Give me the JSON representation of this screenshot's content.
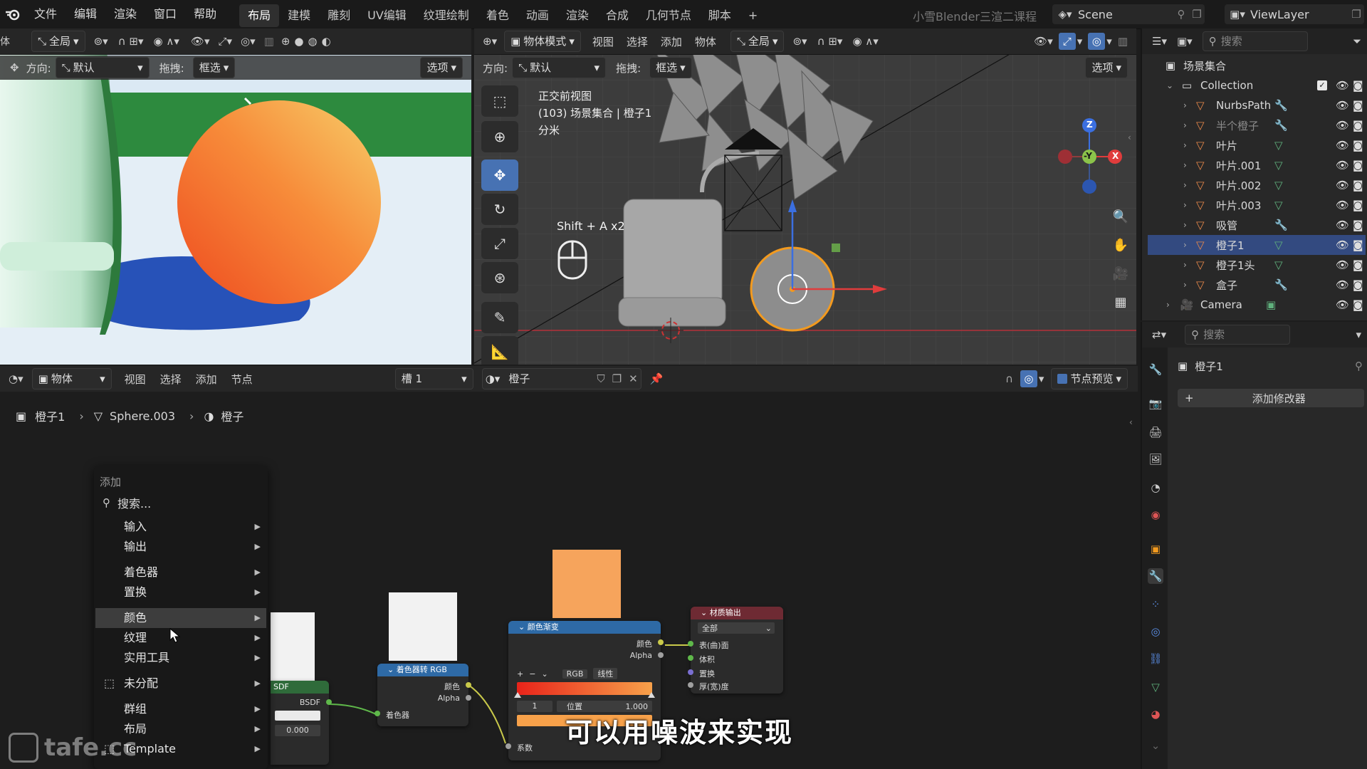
{
  "menubar": {
    "items": [
      "文件",
      "编辑",
      "渲染",
      "窗口",
      "帮助"
    ],
    "workspaces": [
      "布局",
      "建模",
      "雕刻",
      "UV编辑",
      "纹理绘制",
      "着色",
      "动画",
      "渲染",
      "合成",
      "几何节点",
      "脚本"
    ],
    "active_workspace": "布局",
    "add_tab": "+",
    "course_title": "小雪Blender三渲二课程",
    "scene_name": "Scene",
    "view_layer": "ViewLayer"
  },
  "left_viewport": {
    "header": {
      "mode_partial": "体",
      "orientation": "全局"
    },
    "header2": {
      "direction_label": "方向:",
      "direction_value": "默认",
      "drag_label": "拖拽:",
      "drag_value": "框选",
      "options": "选项"
    }
  },
  "main_viewport": {
    "header": {
      "mode": "物体模式",
      "menus": [
        "视图",
        "选择",
        "添加",
        "物体"
      ],
      "orientation": "全局"
    },
    "header2": {
      "direction_label": "方向:",
      "direction_value": "默认",
      "drag_label": "拖拽:",
      "drag_value": "框选",
      "options": "选项"
    },
    "overlay": {
      "view_name": "正交前视图",
      "collection_line": "(103) 场景集合 | 橙子1",
      "unit": "分米"
    },
    "shortcut_hint": "Shift + A x2",
    "gizmo": {
      "z": "Z",
      "y": "-Y",
      "x": "X"
    }
  },
  "outliner": {
    "search_placeholder": "搜索",
    "root": "场景集合",
    "collection": "Collection",
    "items": [
      {
        "name": "NurbsPath",
        "selected": false,
        "dim": false
      },
      {
        "name": "半个橙子",
        "selected": false,
        "dim": true
      },
      {
        "name": "叶片",
        "selected": false,
        "dim": false
      },
      {
        "name": "叶片.001",
        "selected": false,
        "dim": false
      },
      {
        "name": "叶片.002",
        "selected": false,
        "dim": false
      },
      {
        "name": "叶片.003",
        "selected": false,
        "dim": false
      },
      {
        "name": "吸管",
        "selected": false,
        "dim": false
      },
      {
        "name": "橙子1",
        "selected": true,
        "dim": false
      },
      {
        "name": "橙子1头",
        "selected": false,
        "dim": false
      },
      {
        "name": "盒子",
        "selected": false,
        "dim": false
      }
    ],
    "camera": "Camera"
  },
  "properties": {
    "search_placeholder": "搜索",
    "object_name": "橙子1",
    "add_modifier": "添加修改器"
  },
  "node_editor": {
    "header": {
      "type": "物体",
      "menus": [
        "视图",
        "选择",
        "添加",
        "节点"
      ],
      "slot": "槽 1",
      "material": "橙子",
      "preview": "节点预览"
    },
    "breadcrumb": [
      "橙子1",
      "Sphere.003",
      "橙子"
    ]
  },
  "add_menu": {
    "title": "添加",
    "search": "搜索...",
    "groups": [
      [
        "输入",
        "输出"
      ],
      [
        "着色器",
        "置换"
      ],
      [
        "颜色",
        "纹理",
        "实用工具"
      ],
      [
        "未分配"
      ],
      [
        "群组",
        "布局",
        "Template"
      ]
    ],
    "hovered": "颜色"
  },
  "nodes": {
    "bsdf": {
      "output": "BSDF",
      "value": "0.000",
      "head_partial": "SDF"
    },
    "shader_to_rgb": {
      "title": "着色器转 RGB",
      "out_color": "颜色",
      "out_alpha": "Alpha",
      "in_shader": "着色器"
    },
    "color_ramp": {
      "title": "颜色渐变",
      "out_color": "颜色",
      "out_alpha": "Alpha",
      "mode": "RGB",
      "interp": "线性",
      "index": "1",
      "pos_label": "位置",
      "pos_value": "1.000",
      "factor": "系数",
      "color_start": "#e8231a",
      "color_end": "#f7a14a",
      "swatch": "#f6a45c"
    },
    "material_output": {
      "title": "材质输出",
      "target": "全部",
      "surface": "表(曲)面",
      "volume": "体积",
      "displacement": "置换",
      "thickness": "厚(宽)度"
    }
  },
  "subtitle": "可以用噪波来实现",
  "watermark": "tafe.cc"
}
